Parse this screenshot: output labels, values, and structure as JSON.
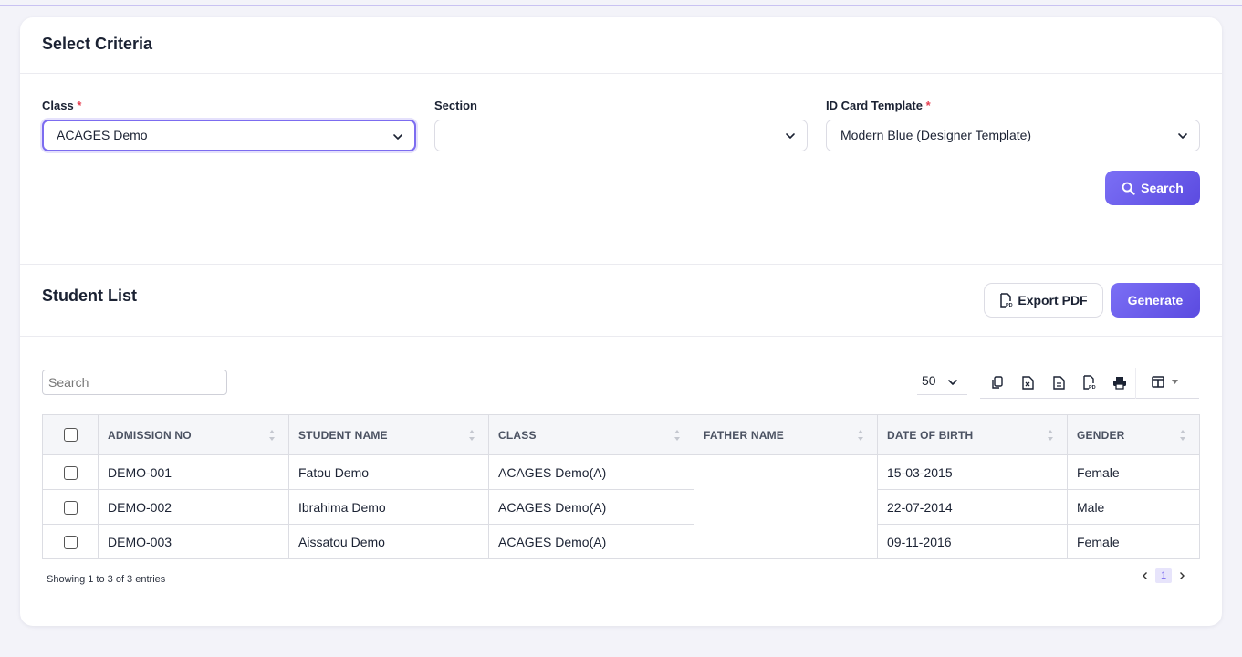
{
  "criteria": {
    "title": "Select Criteria",
    "class_label": "Class",
    "class_value": "ACAGES Demo",
    "section_label": "Section",
    "section_value": "",
    "template_label": "ID Card Template",
    "template_value": "Modern Blue (Designer Template)",
    "required_mark": "*",
    "search_button": "Search"
  },
  "student_list": {
    "title": "Student List",
    "export_pdf": "Export PDF",
    "generate": "Generate",
    "search_placeholder": "Search",
    "page_length": "50",
    "columns": [
      "ADMISSION NO",
      "STUDENT NAME",
      "CLASS",
      "FATHER NAME",
      "DATE OF BIRTH",
      "GENDER"
    ],
    "rows": [
      {
        "admission_no": "DEMO-001",
        "name": "Fatou Demo",
        "class": "ACAGES Demo(A)",
        "father": "",
        "dob": "15-03-2015",
        "gender": "Female"
      },
      {
        "admission_no": "DEMO-002",
        "name": "Ibrahima Demo",
        "class": "ACAGES Demo(A)",
        "father": "",
        "dob": "22-07-2014",
        "gender": "Male"
      },
      {
        "admission_no": "DEMO-003",
        "name": "Aissatou Demo",
        "class": "ACAGES Demo(A)",
        "father": "",
        "dob": "09-11-2016",
        "gender": "Female"
      }
    ],
    "info": "Showing 1 to 3 of 3 entries",
    "current_page": "1",
    "tool_icons": [
      "copy-icon",
      "excel-icon",
      "csv-icon",
      "pdf-icon",
      "print-icon",
      "columns-icon"
    ]
  },
  "colors": {
    "accent": "#6a5ae8",
    "link": "#7159e0",
    "required": "#e53e4f"
  }
}
